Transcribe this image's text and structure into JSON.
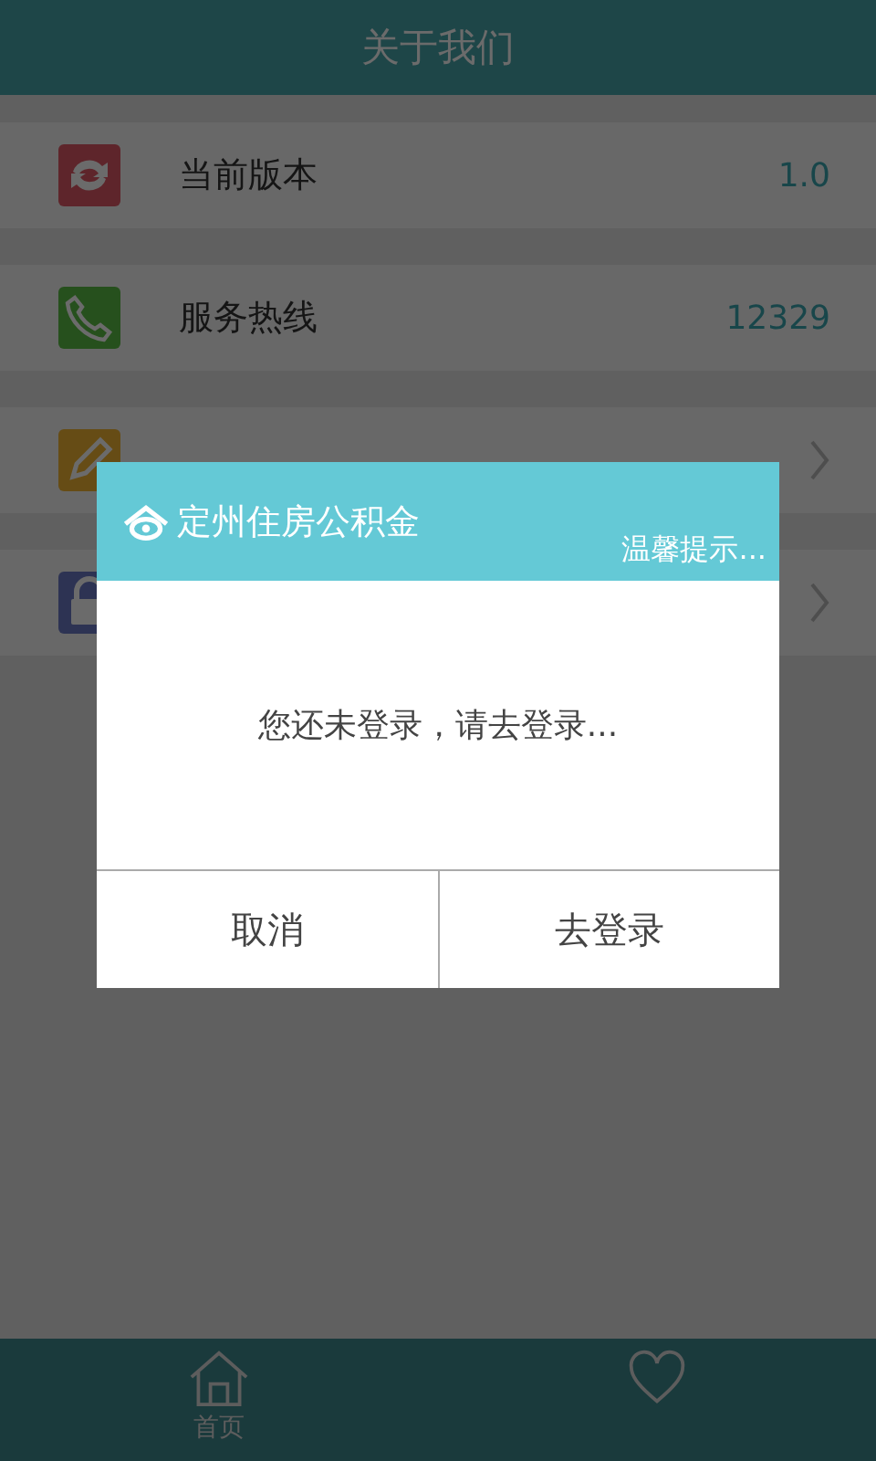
{
  "header": {
    "title": "关于我们"
  },
  "rows": [
    {
      "kind": "info",
      "label": "当前版本",
      "value": "1.0"
    },
    {
      "kind": "info",
      "label": "服务热线",
      "value": "12329"
    },
    {
      "kind": "link"
    },
    {
      "kind": "link"
    }
  ],
  "dialog": {
    "brand": "定州住房公积金",
    "subtitle": "温馨提示...",
    "message": "您还未登录，请去登录...",
    "buttons": [
      "取消",
      "去登录"
    ]
  },
  "tab_bar": [
    {
      "kind": "labeled",
      "label": "首页"
    },
    {
      "kind": "icon_only"
    }
  ]
}
